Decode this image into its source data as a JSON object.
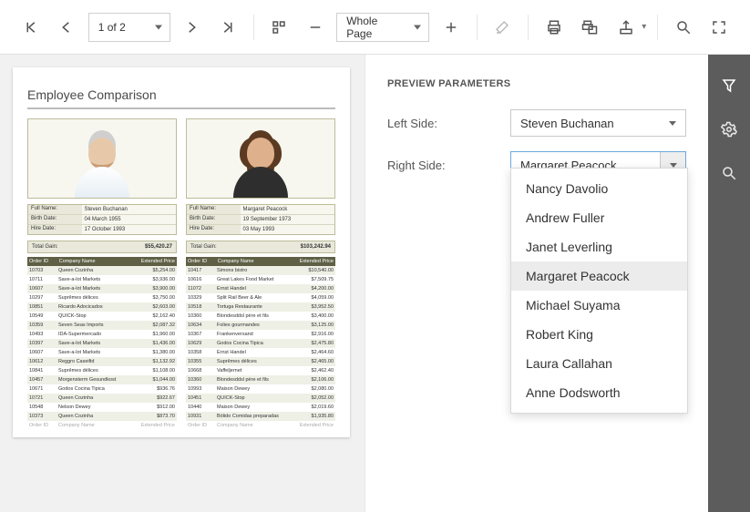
{
  "toolbar": {
    "page_indicator": "1 of 2",
    "zoom_mode": "Whole Page"
  },
  "report": {
    "title": "Employee Comparison",
    "info_labels": {
      "full_name": "Full Name:",
      "birth_date": "Birth Date:",
      "hire_date": "Hire Date:"
    },
    "total_gain_label": "Total Gain:",
    "columns": {
      "order_id": "Order ID",
      "company": "Company Name",
      "price": "Extended Price"
    },
    "left": {
      "full_name": "Steven Buchanan",
      "birth_date": "04 March 1955",
      "hire_date": "17 October 1993",
      "total_gain": "$55,420.27",
      "rows": [
        {
          "id": "10703",
          "co": "Queen Cozinha",
          "pr": "$5,254.00"
        },
        {
          "id": "10711",
          "co": "Save-a-lot Markets",
          "pr": "$3,936.00"
        },
        {
          "id": "10607",
          "co": "Save-a-lot Markets",
          "pr": "$3,900.00"
        },
        {
          "id": "10297",
          "co": "Suprêmes délices",
          "pr": "$3,750.00"
        },
        {
          "id": "10851",
          "co": "Ricardo Adocicados",
          "pr": "$2,603.00"
        },
        {
          "id": "10549",
          "co": "QUICK-Stop",
          "pr": "$2,162.40"
        },
        {
          "id": "10359",
          "co": "Seven Seas Imports",
          "pr": "$2,087.32"
        },
        {
          "id": "10493",
          "co": "IDA-Supermercado",
          "pr": "$1,960.00"
        },
        {
          "id": "10397",
          "co": "Save-a-lot Markets",
          "pr": "$1,436.00"
        },
        {
          "id": "10607",
          "co": "Save-a-lot Markets",
          "pr": "$1,380.00"
        },
        {
          "id": "10612",
          "co": "Reggro Caseifid",
          "pr": "$1,132.92"
        },
        {
          "id": "10841",
          "co": "Suprêmes délices",
          "pr": "$1,108.00"
        },
        {
          "id": "10457",
          "co": "Morgensterm Gesundkost",
          "pr": "$1,044.00"
        },
        {
          "id": "10671",
          "co": "Godos Cocina Tipica",
          "pr": "$936.76"
        },
        {
          "id": "10721",
          "co": "Queen Cozinha",
          "pr": "$922.67"
        },
        {
          "id": "10548",
          "co": "Nelson Dewey",
          "pr": "$912.00"
        },
        {
          "id": "10373",
          "co": "Queen Cozinha",
          "pr": "$873.70"
        }
      ]
    },
    "right": {
      "full_name": "Margaret Peacock",
      "birth_date": "19 September 1973",
      "hire_date": "03 May 1993",
      "total_gain": "$103,242.94",
      "rows": [
        {
          "id": "10417",
          "co": "Simons bistro",
          "pr": "$10,540.00"
        },
        {
          "id": "10616",
          "co": "Great Lakes Food Market",
          "pr": "$7,509.75"
        },
        {
          "id": "11072",
          "co": "Ernst Handel",
          "pr": "$4,200.00"
        },
        {
          "id": "10329",
          "co": "Split Rail Beer & Ale",
          "pr": "$4,059.00"
        },
        {
          "id": "10518",
          "co": "Tortuga Restaurante",
          "pr": "$3,952.50"
        },
        {
          "id": "10360",
          "co": "Blondesddsl père et fils",
          "pr": "$3,400.00"
        },
        {
          "id": "10634",
          "co": "Folies gourmandes",
          "pr": "$3,125.00"
        },
        {
          "id": "10367",
          "co": "Frankenversand",
          "pr": "$2,916.00"
        },
        {
          "id": "10629",
          "co": "Godos Cocina Tipica",
          "pr": "$2,475.80"
        },
        {
          "id": "10358",
          "co": "Ernst Handel",
          "pr": "$2,464.60"
        },
        {
          "id": "10355",
          "co": "Suprêmes délices",
          "pr": "$2,465.00"
        },
        {
          "id": "10668",
          "co": "Vaffeljernet",
          "pr": "$2,462.40"
        },
        {
          "id": "10360",
          "co": "Blondesddsl père et fils",
          "pr": "$2,106.00"
        },
        {
          "id": "10993",
          "co": "Maison Dewey",
          "pr": "$2,080.00"
        },
        {
          "id": "10451",
          "co": "QUICK-Stop",
          "pr": "$2,052.00"
        },
        {
          "id": "10440",
          "co": "Maison Dewey",
          "pr": "$2,019.60"
        },
        {
          "id": "10931",
          "co": "Bólido Comidas preparadas",
          "pr": "$1,935.80"
        }
      ]
    }
  },
  "parameters": {
    "heading": "PREVIEW PARAMETERS",
    "left_label": "Left Side:",
    "right_label": "Right Side:",
    "left_value": "Steven Buchanan",
    "right_value": "Margaret Peacock",
    "options": [
      "Nancy Davolio",
      "Andrew Fuller",
      "Janet Leverling",
      "Margaret Peacock",
      "Michael Suyama",
      "Robert King",
      "Laura Callahan",
      "Anne Dodsworth"
    ],
    "selected_option_index": 3
  }
}
